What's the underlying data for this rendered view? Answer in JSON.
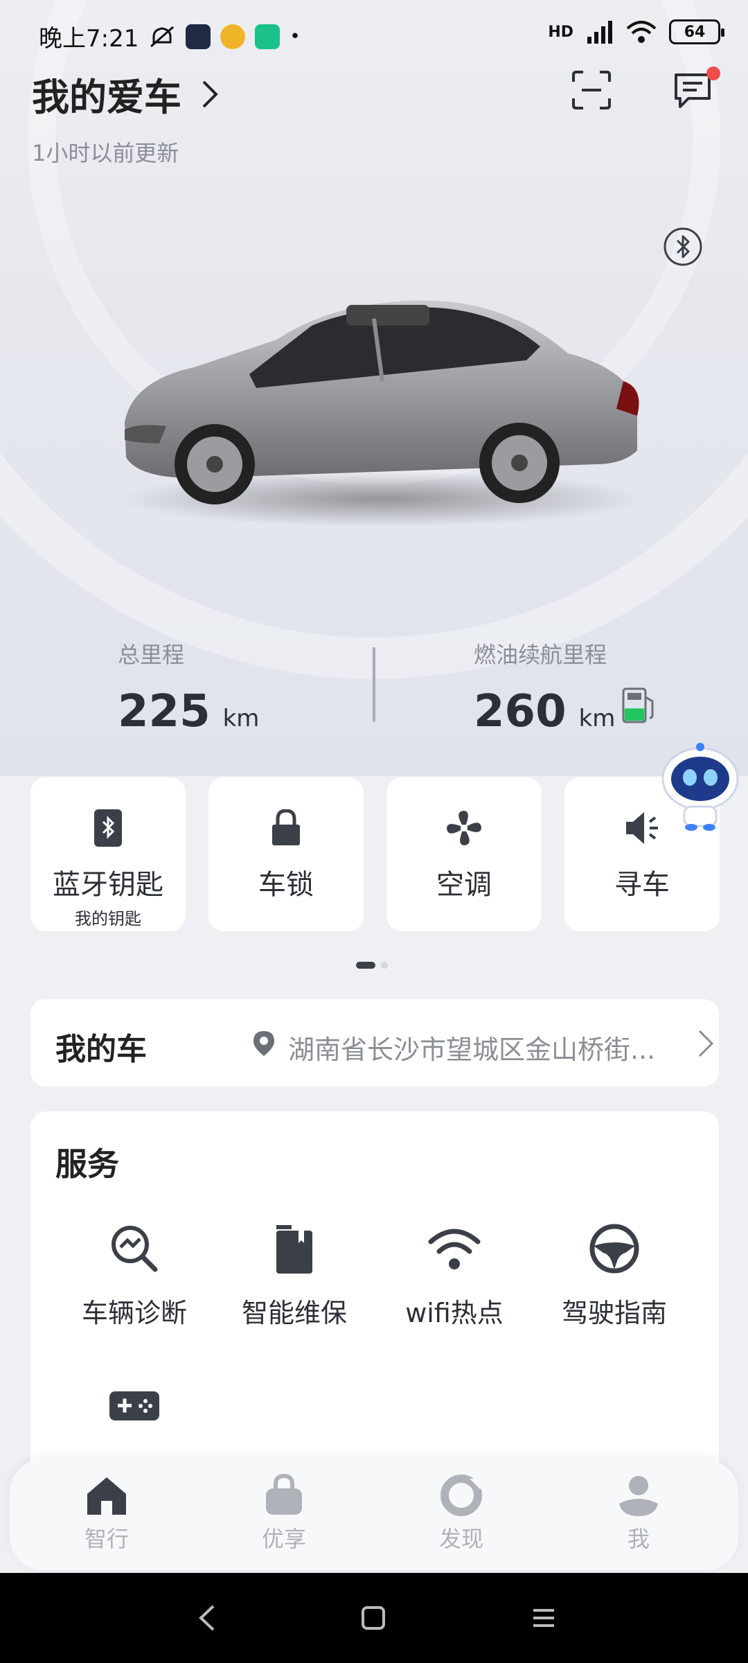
{
  "status_bar": {
    "time": "晚上7:21",
    "battery": "64",
    "network_label": "HD"
  },
  "header": {
    "title": "我的爱车",
    "updated": "1小时以前更新"
  },
  "stats": {
    "total_mileage_label": "总里程",
    "total_mileage_value": "225",
    "total_mileage_unit": "km",
    "range_label": "燃油续航里程",
    "range_value": "260",
    "range_unit": "km",
    "fuel_level": 0.4
  },
  "quick_actions": [
    {
      "label": "蓝牙钥匙",
      "sub": "我的钥匙",
      "icon": "bluetooth-key-icon"
    },
    {
      "label": "车锁",
      "icon": "lock-icon"
    },
    {
      "label": "空调",
      "icon": "fan-icon"
    },
    {
      "label": "寻车",
      "icon": "speaker-icon"
    }
  ],
  "pager": {
    "pages": 2,
    "current": 1
  },
  "my_car": {
    "title": "我的车",
    "address": "湖南省长沙市望城区金山桥街..."
  },
  "services": {
    "title": "服务",
    "items": [
      {
        "label": "车辆诊断",
        "icon": "diagnosis-icon"
      },
      {
        "label": "智能维保",
        "icon": "maintenance-icon"
      },
      {
        "label": "wifi热点",
        "icon": "wifi-icon"
      },
      {
        "label": "驾驶指南",
        "icon": "steering-wheel-icon"
      }
    ]
  },
  "bottom_nav": [
    {
      "label": "智行",
      "icon": "home-icon",
      "active": true
    },
    {
      "label": "优享",
      "icon": "bag-icon"
    },
    {
      "label": "发现",
      "icon": "discover-icon"
    },
    {
      "label": "我",
      "icon": "profile-icon"
    }
  ],
  "colors": {
    "accent_dark": "#3b4048",
    "fuel_green": "#22c55e",
    "notification_red": "#f04b4b"
  }
}
